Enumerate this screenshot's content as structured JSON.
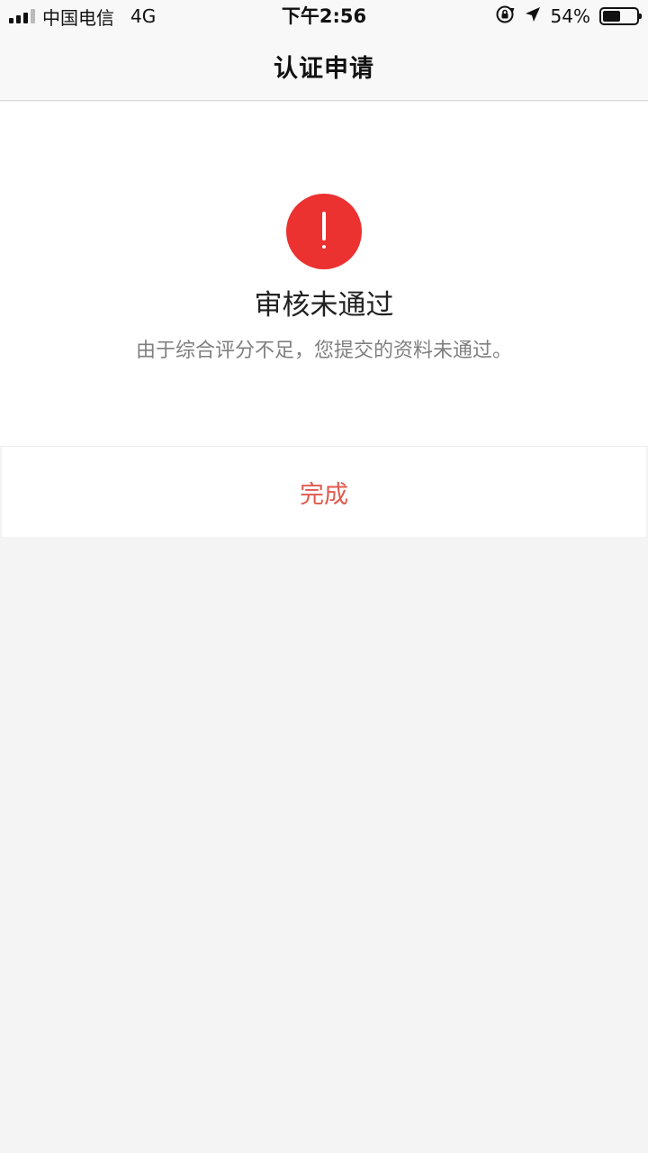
{
  "status_bar": {
    "carrier": "中国电信",
    "network": "4G",
    "time": "下午2:56",
    "battery_percent_text": "54%",
    "battery_level": 0.54,
    "icons": [
      "signal-icon",
      "rotation-lock-icon",
      "location-arrow-icon",
      "battery-icon"
    ]
  },
  "nav": {
    "title": "认证申请"
  },
  "result": {
    "icon": "alert-icon",
    "icon_color": "#ec3131",
    "title": "审核未通过",
    "description": "由于综合评分不足，您提交的资料未通过。"
  },
  "actions": {
    "done_label": "完成",
    "done_color": "#e05a4e"
  }
}
